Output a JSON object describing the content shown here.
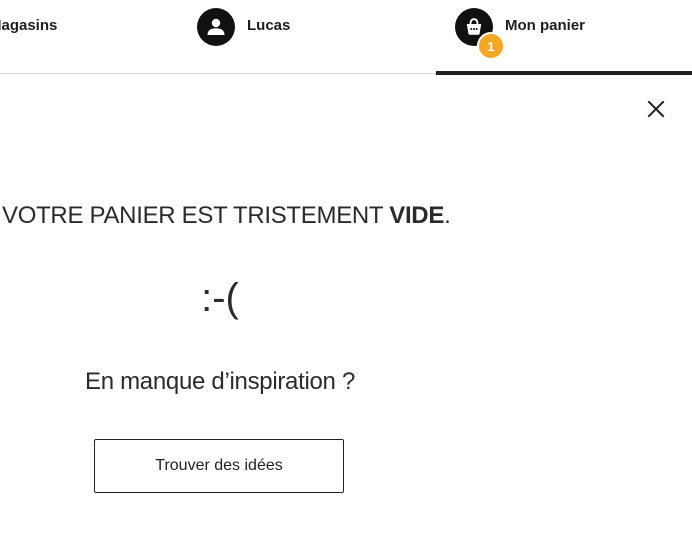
{
  "nav": {
    "stores_label": "Magasins",
    "account_label": "Lucas",
    "cart_label": "Mon panier",
    "cart_count": "1",
    "active_item": "cart",
    "badge_color": "#f5a623",
    "active_underline_color": "#222222"
  },
  "icons": {
    "account": "user-icon",
    "cart": "shopping-bag-icon",
    "close": "close-icon"
  },
  "empty_cart": {
    "title_prefix": "VOTRE PANIER EST TRISTEMENT ",
    "title_emphasis": "VIDE",
    "title_suffix": ".",
    "emoticon": ":-(",
    "inspiration_text": "En manque d’inspiration ?",
    "button_label": "Trouver des idées"
  }
}
